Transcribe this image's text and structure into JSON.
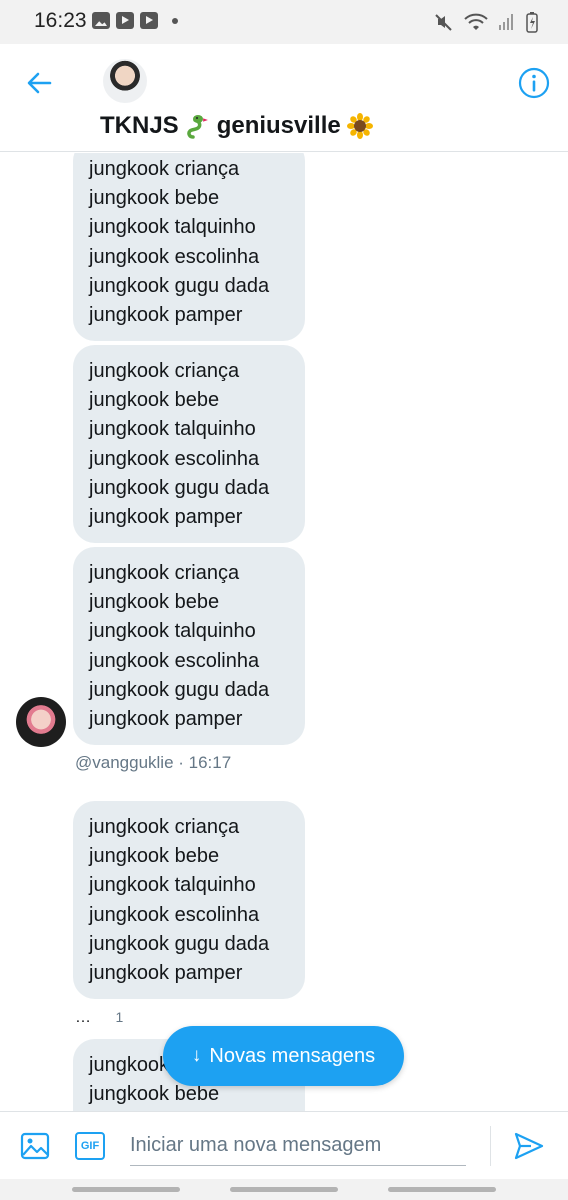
{
  "status_bar": {
    "time": "16:23"
  },
  "header": {
    "title": "TKNJS",
    "title_suffix": "geniusville",
    "colors": {
      "accent": "#1da1f2"
    }
  },
  "messages": [
    {
      "lines": [
        "jungkook criança",
        "jungkook bebe",
        "jungkook talquinho",
        "jungkook escolinha",
        "jungkook gugu dada",
        "jungkook pamper"
      ]
    },
    {
      "lines": [
        "jungkook criança",
        "jungkook bebe",
        "jungkook talquinho",
        "jungkook escolinha",
        "jungkook gugu dada",
        "jungkook pamper"
      ]
    },
    {
      "lines": [
        "jungkook criança",
        "jungkook bebe",
        "jungkook talquinho",
        "jungkook escolinha",
        "jungkook gugu dada",
        "jungkook pamper"
      ]
    },
    {
      "lines": [
        "jungkook criança",
        "jungkook bebe",
        "jungkook talquinho",
        "jungkook escolinha",
        "jungkook gugu dada",
        "jungkook pamper"
      ]
    },
    {
      "lines": [
        "jungkook criança",
        "jungkook bebe"
      ]
    }
  ],
  "meta": {
    "sender_timestamp": "@vangguklie · 16:17",
    "ellipsis": "…",
    "reaction_count": "1"
  },
  "new_messages_pill": {
    "arrow": "↓",
    "label": "Novas mensagens"
  },
  "composer": {
    "placeholder": "Iniciar uma nova mensagem",
    "gif_label": "GIF"
  }
}
